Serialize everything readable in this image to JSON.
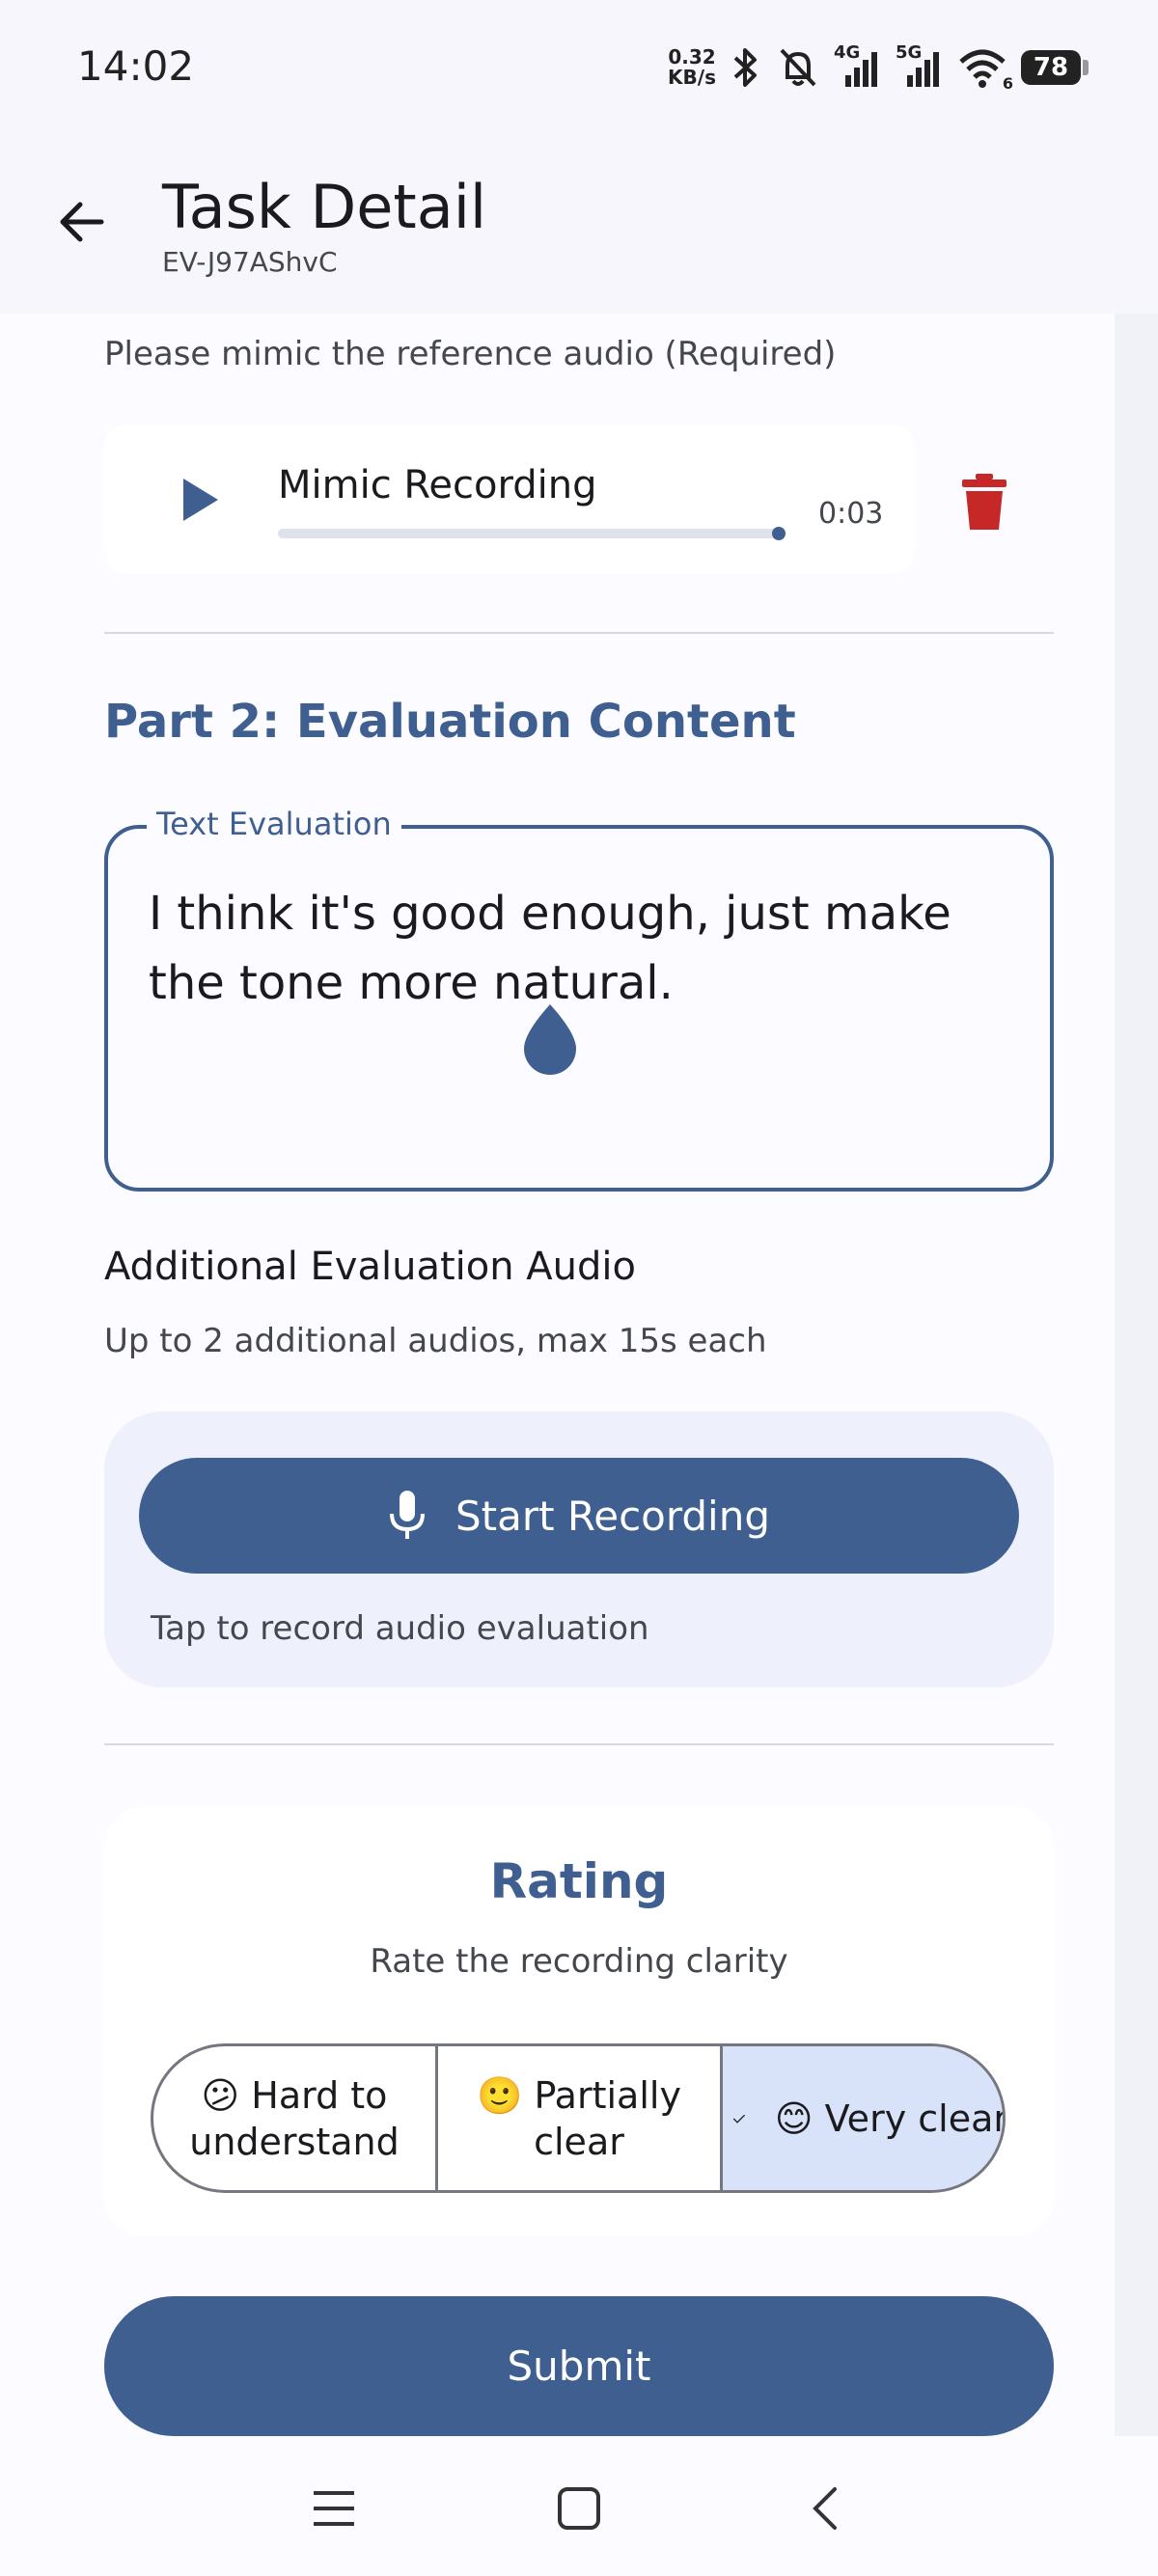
{
  "status_bar": {
    "time": "14:02",
    "net_speed_value": "0.32",
    "net_speed_unit": "KB/s",
    "net_4g": "4G",
    "net_5g": "5G",
    "wifi_sub": "6",
    "battery": "78"
  },
  "app_bar": {
    "title": "Task Detail",
    "subtitle": "EV-J97AShvC"
  },
  "mimic": {
    "label": "Please mimic the reference audio (Required)",
    "audio_title": "Mimic Recording",
    "duration": "0:03",
    "progress": 1.0
  },
  "evaluation": {
    "section_title": "Part 2: Evaluation Content",
    "text_label": "Text Evaluation",
    "text_value": "I think it's good enough, just make the tone more natural."
  },
  "additional_audio": {
    "title": "Additional Evaluation Audio",
    "description": "Up to 2 additional audios, max 15s each",
    "record_button": "Start Recording",
    "hint": "Tap to record audio evaluation"
  },
  "rating": {
    "title": "Rating",
    "description": "Rate the recording clarity",
    "options": [
      {
        "emoji": "😕",
        "line1": "Hard to",
        "line2": "understand",
        "selected": false
      },
      {
        "emoji": "🙂",
        "line1": "Partially",
        "line2": "clear",
        "selected": false
      },
      {
        "emoji": "😊",
        "line1": "Very clear",
        "line2": "",
        "selected": true
      }
    ]
  },
  "submit_label": "Submit",
  "colors": {
    "primary": "#3f5f90",
    "delete": "#c62828",
    "selected_segment": "#d8e2f8"
  },
  "icons": {
    "back": "arrow-back-icon",
    "play": "play-icon",
    "delete": "trash-icon",
    "mic": "mic-icon",
    "check": "check-icon"
  }
}
